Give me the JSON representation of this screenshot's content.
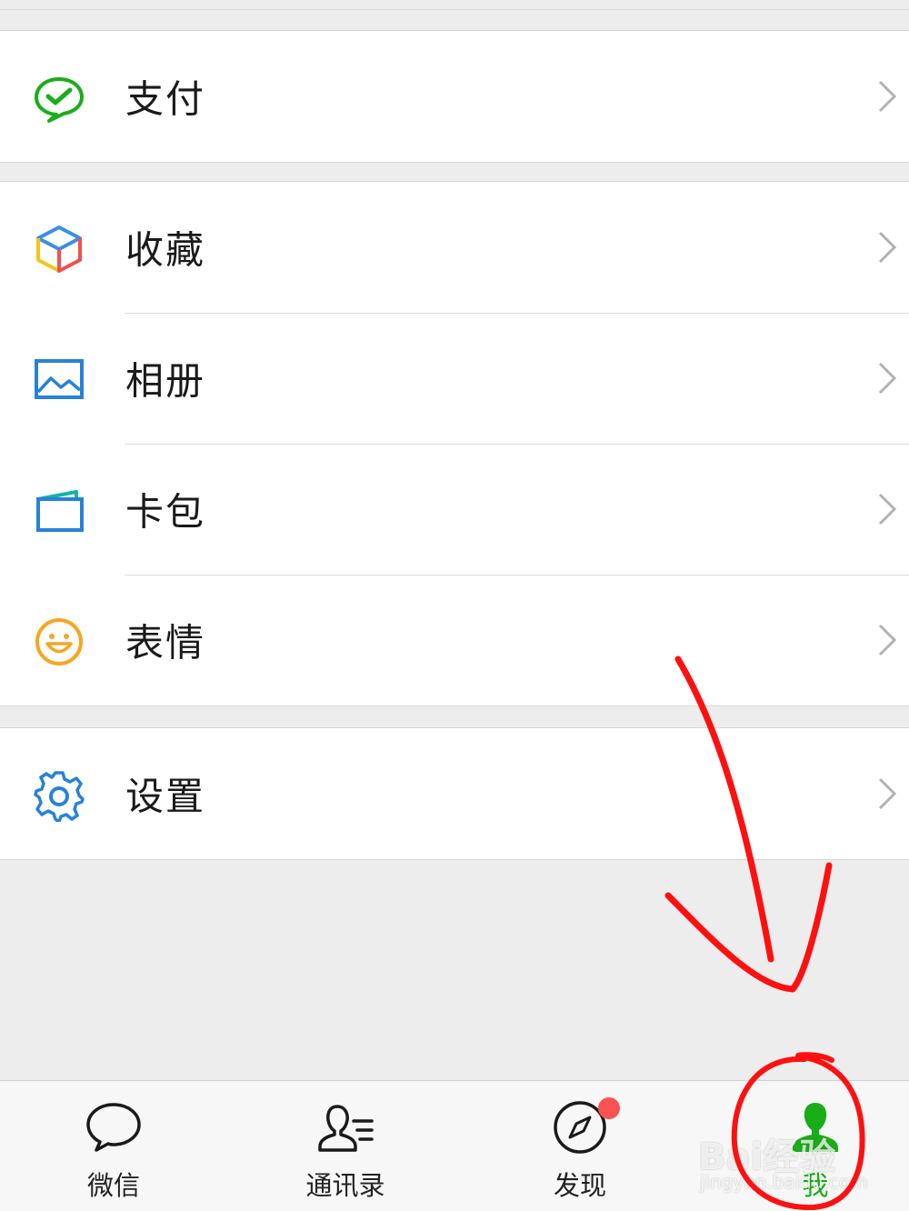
{
  "menu": {
    "pay": {
      "label": "支付",
      "icon": "wechat-pay-icon"
    },
    "favorites": {
      "label": "收藏",
      "icon": "cube-icon"
    },
    "album": {
      "label": "相册",
      "icon": "picture-icon"
    },
    "cards": {
      "label": "卡包",
      "icon": "wallet-icon"
    },
    "stickers": {
      "label": "表情",
      "icon": "smiley-icon"
    },
    "settings": {
      "label": "设置",
      "icon": "gear-icon"
    }
  },
  "tabbar": {
    "chats": {
      "label": "微信",
      "icon": "chat-bubble-icon"
    },
    "contacts": {
      "label": "通讯录",
      "icon": "contacts-icon"
    },
    "discover": {
      "label": "发现",
      "icon": "compass-icon",
      "badge": true
    },
    "me": {
      "label": "我",
      "icon": "person-icon",
      "active": true
    }
  },
  "watermark": {
    "brand": "Bai经验",
    "url": "jingyan.baidu.com"
  },
  "colors": {
    "accent_green": "#1aad19",
    "badge_red": "#fa5151",
    "annotation_red": "#ff1010",
    "icon_blue": "#2782d7",
    "icon_orange": "#f5a623"
  }
}
